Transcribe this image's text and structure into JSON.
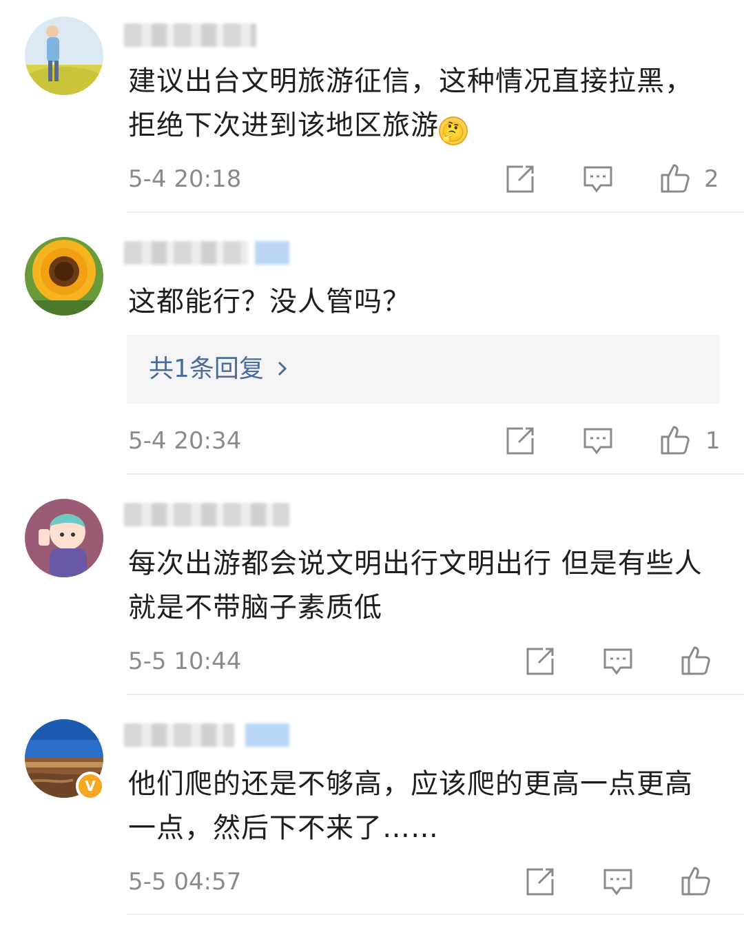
{
  "comments": [
    {
      "username": "用户",
      "text": "建议出台文明旅游征信，这种情况直接拉黑，拒绝下次进到该地区旅游",
      "emoji": "thinking-face",
      "time": "5-4 20:18",
      "likes": "2",
      "reply_summary": null
    },
    {
      "username": "用户",
      "text": "这都能行？没人管吗？",
      "time": "5-4 20:34",
      "likes": "1",
      "reply_summary": "共1条回复"
    },
    {
      "username": "用户",
      "text": "每次出游都会说文明出行文明出行 但是有些人就是不带脑子素质低",
      "time": "5-5 10:44",
      "likes": "",
      "reply_summary": null
    },
    {
      "username": "用户",
      "text": "他们爬的还是不够高，应该爬的更高一点更高一点，然后下不来了……",
      "time": "5-5 04:57",
      "likes": "",
      "reply_summary": null,
      "verified_badge": "V"
    }
  ],
  "icons": {
    "share": "share-icon",
    "comment": "comment-icon",
    "like": "thumbs-up-icon"
  },
  "colors": {
    "link": "#4a6c99",
    "meta": "#8a8a8a",
    "badge": "#f5a623"
  }
}
